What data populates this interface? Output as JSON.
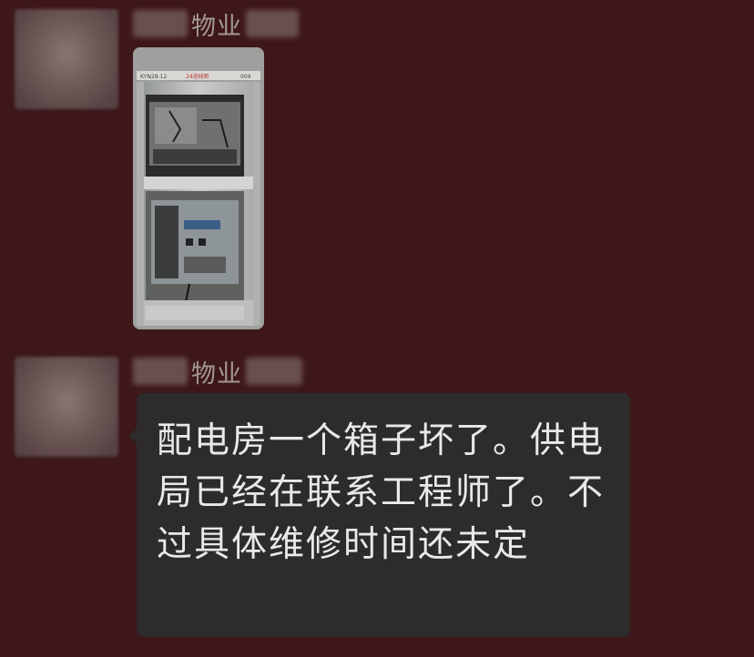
{
  "messages": [
    {
      "sender_name": "物业",
      "type": "image",
      "image_label_left": "KYN28-12",
      "image_label_center": "24进线柜",
      "image_label_right": "004"
    },
    {
      "sender_name": "物业",
      "type": "text",
      "text": "配电房一个箱子坏了。供电局已经在联系工程师了。不过具体维修时间还未定"
    }
  ],
  "colors": {
    "background": "#3d1719",
    "bubble": "#2e2b2c",
    "bubble_text": "#e9e9e9",
    "sender_text": "#a39897"
  }
}
